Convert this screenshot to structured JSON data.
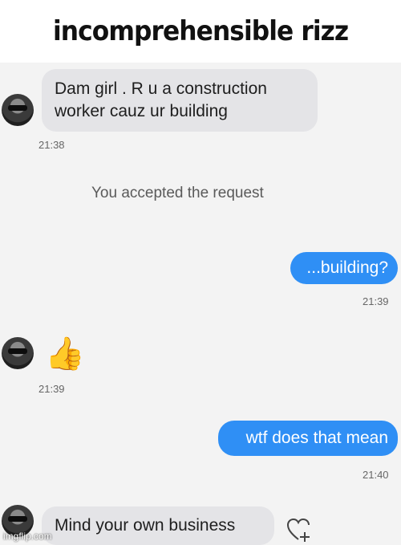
{
  "caption": "incomprehensible rizz",
  "messages": {
    "m1": {
      "text_line1": "Dam girl . R u a construction",
      "text_line2": "worker cauz ur building",
      "time": "21:38"
    },
    "system_notice": "You accepted the request",
    "m2": {
      "text": "...building?",
      "time": "21:39"
    },
    "m3": {
      "emoji": "👍",
      "time": "21:39"
    },
    "m4": {
      "text": "wtf does that mean",
      "time": "21:40"
    },
    "m5": {
      "text": "Mind your own business"
    }
  },
  "icons": {
    "avatar": "profile-avatar",
    "react": "heart-plus-icon"
  },
  "watermark": "imgflip.com",
  "colors": {
    "outgoing_bubble": "#2f8ff5",
    "incoming_bubble": "#e4e4e7",
    "chat_bg": "#f3f3f3"
  }
}
